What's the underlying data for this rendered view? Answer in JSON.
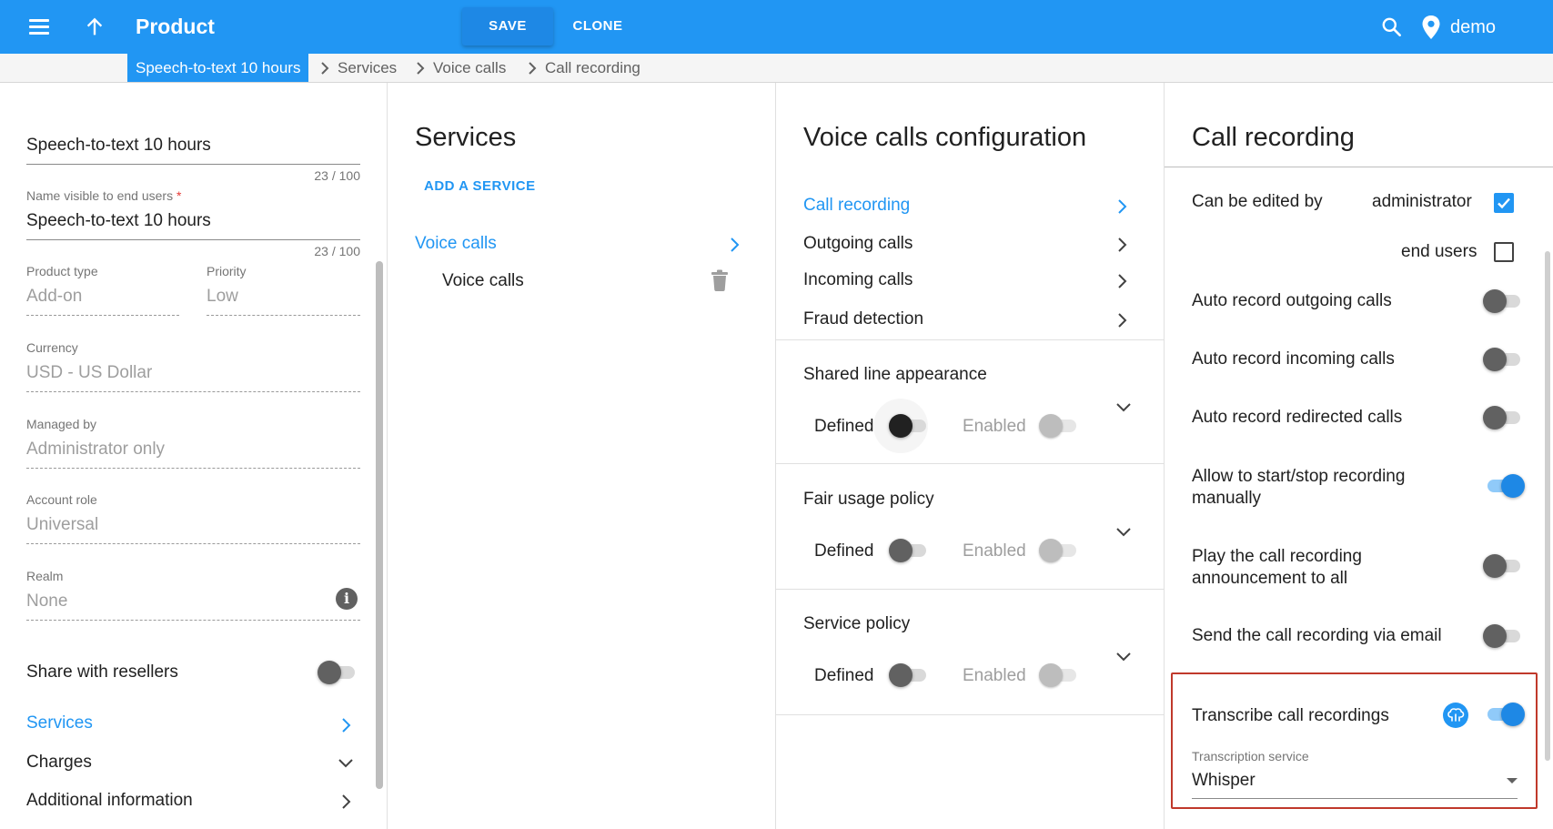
{
  "header": {
    "title": "Product",
    "save_label": "SAVE",
    "clone_label": "CLONE",
    "user_name": "demo"
  },
  "breadcrumb": {
    "current": "Speech-to-text 10 hours",
    "items": [
      "Services",
      "Voice calls",
      "Call recording"
    ]
  },
  "product_panel": {
    "name_value": "Speech-to-text 10 hours",
    "name_counter": "23 / 100",
    "visible_name_label": "Name visible to end users",
    "visible_name_required": "*",
    "visible_name_value": "Speech-to-text 10 hours",
    "visible_name_counter": "23 / 100",
    "product_type_label": "Product type",
    "product_type_value": "Add-on",
    "priority_label": "Priority",
    "priority_value": "Low",
    "currency_label": "Currency",
    "currency_value": "USD - US Dollar",
    "managed_by_label": "Managed by",
    "managed_by_value": "Administrator only",
    "account_role_label": "Account role",
    "account_role_value": "Universal",
    "realm_label": "Realm",
    "realm_value": "None",
    "share_label": "Share with resellers",
    "share_on": false,
    "services_label": "Services",
    "charges_label": "Charges",
    "additional_label": "Additional information"
  },
  "services_panel": {
    "title": "Services",
    "add_label": "ADD A SERVICE",
    "group_label": "Voice calls",
    "item_label": "Voice calls"
  },
  "voice_panel": {
    "title": "Voice calls configuration",
    "nav": [
      "Call recording",
      "Outgoing calls",
      "Incoming calls",
      "Fraud detection"
    ],
    "sections": [
      {
        "title": "Shared line appearance",
        "defined_label": "Defined",
        "enabled_label": "Enabled"
      },
      {
        "title": "Fair usage policy",
        "defined_label": "Defined",
        "enabled_label": "Enabled"
      },
      {
        "title": "Service policy",
        "defined_label": "Defined",
        "enabled_label": "Enabled"
      }
    ]
  },
  "recording_panel": {
    "title": "Call recording",
    "edited_by_label": "Can be edited by",
    "admin_label": "administrator",
    "admin_checked": true,
    "end_users_label": "end users",
    "end_users_checked": false,
    "rows": [
      {
        "label": "Auto record outgoing calls",
        "on": false
      },
      {
        "label": "Auto record incoming calls",
        "on": false
      },
      {
        "label": "Auto record redirected calls",
        "on": false
      },
      {
        "label_line1": "Allow to start/stop recording",
        "label_line2": "manually",
        "on": true
      },
      {
        "label_line1": "Play the call recording",
        "label_line2": "announcement to all",
        "on": false
      },
      {
        "label": "Send the call recording via email",
        "on": false
      }
    ],
    "transcribe_label": "Transcribe call recordings",
    "transcribe_on": true,
    "service_label": "Transcription service",
    "service_value": "Whisper"
  },
  "colors": {
    "primary": "#2196f3",
    "highlight": "#c0392b"
  }
}
